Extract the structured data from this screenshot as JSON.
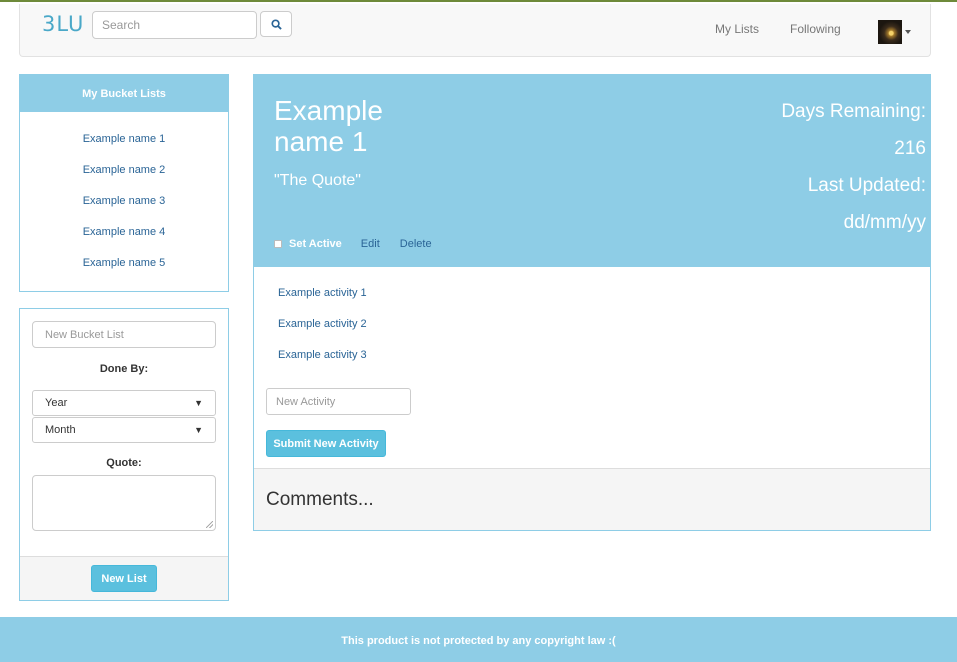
{
  "app": {
    "logo": "3LU"
  },
  "search": {
    "placeholder": "Search"
  },
  "nav": {
    "my_lists": "My Lists",
    "following": "Following"
  },
  "sidebar": {
    "title": "My Bucket Lists",
    "items": [
      {
        "label": "Example name 1"
      },
      {
        "label": "Example name 2"
      },
      {
        "label": "Example name 3"
      },
      {
        "label": "Example name 4"
      },
      {
        "label": "Example name 5"
      }
    ]
  },
  "new_list_form": {
    "name_placeholder": "New Bucket List",
    "done_by_label": "Done By:",
    "year_value": "Year",
    "month_value": "Month",
    "quote_label": "Quote:",
    "submit_label": "New List"
  },
  "bucket_list": {
    "title": "Example name 1",
    "quote": "\"The Quote\"",
    "days_remaining_label": "Days Remaining:",
    "days_remaining_value": "216",
    "last_updated_label": "Last Updated:",
    "last_updated_value": "dd/mm/yy",
    "set_active_label": "Set Active",
    "edit_label": "Edit",
    "delete_label": "Delete",
    "activities": [
      {
        "label": "Example activity 1"
      },
      {
        "label": "Example activity 2"
      },
      {
        "label": "Example activity 3"
      }
    ],
    "new_activity_placeholder": "New Activity",
    "submit_activity_label": "Submit New Activity",
    "comments_heading": "Comments..."
  },
  "footer": {
    "text": "This product is not protected by any copyright law :("
  },
  "colors": {
    "accent": "#8ecde6",
    "button": "#5bc0de",
    "link": "#2a6496"
  },
  "icons": {
    "search": "search-icon",
    "avatar": "avatar",
    "dropdown": "chevron-down-icon"
  }
}
